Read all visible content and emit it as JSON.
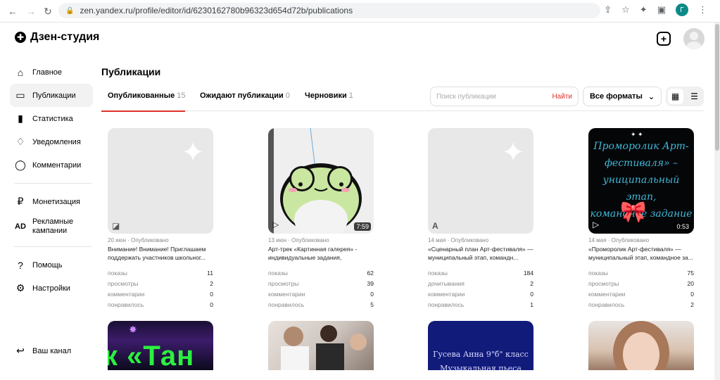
{
  "browser": {
    "url": "zen.yandex.ru/profile/editor/id/6230162780b96323d654d72b/publications",
    "profile_initial": "Г"
  },
  "app": {
    "logo_text": "Дзен-студия"
  },
  "sidebar": {
    "items": [
      {
        "label": "Главное",
        "icon": "home-icon"
      },
      {
        "label": "Публикации",
        "icon": "publications-icon",
        "active": true
      },
      {
        "label": "Статистика",
        "icon": "stats-icon"
      },
      {
        "label": "Уведомления",
        "icon": "bell-icon"
      },
      {
        "label": "Комментарии",
        "icon": "comment-icon"
      },
      {
        "label": "Монетизация",
        "icon": "ruble-icon"
      },
      {
        "label": "Рекламные кампании",
        "icon": "ad-icon"
      },
      {
        "label": "Помощь",
        "icon": "help-icon"
      },
      {
        "label": "Настройки",
        "icon": "gear-icon"
      }
    ],
    "bottom": {
      "label": "Ваш канал",
      "icon": "exit-icon"
    }
  },
  "main": {
    "title": "Публикации",
    "tabs": [
      {
        "label": "Опубликованные",
        "count": "15",
        "active": true
      },
      {
        "label": "Ожидают публикации",
        "count": "0"
      },
      {
        "label": "Черновики",
        "count": "1"
      }
    ],
    "search": {
      "placeholder": "Поиск публикации",
      "button": "Найти"
    },
    "formats": {
      "label": "Все форматы"
    }
  },
  "cards": [
    {
      "meta": "20 июн · Опубликовано",
      "title": "Внимание! Внимание! Приглашаем поддержать участников школьног...",
      "stats": [
        {
          "k": "показы",
          "v": "11"
        },
        {
          "k": "просмотры",
          "v": "2"
        },
        {
          "k": "комментарии",
          "v": "0"
        },
        {
          "k": "понравилось",
          "v": "0"
        }
      ]
    },
    {
      "meta": "13 июн · Опубликовано",
      "title": "Арт-трек «Картинная галерея» - индивидуальные задания, региональ...",
      "duration": "7:59",
      "stats": [
        {
          "k": "показы",
          "v": "62"
        },
        {
          "k": "просмотры",
          "v": "39"
        },
        {
          "k": "комментарии",
          "v": "0"
        },
        {
          "k": "понравилось",
          "v": "5"
        }
      ]
    },
    {
      "meta": "14 мая · Опубликовано",
      "title": "«Сценарный план Арт-фестиваля» — муниципальный этап, командн...",
      "type_letter": "A",
      "stats": [
        {
          "k": "показы",
          "v": "184"
        },
        {
          "k": "дочитывания",
          "v": "2"
        },
        {
          "k": "комментарии",
          "v": "0"
        },
        {
          "k": "понравилось",
          "v": "1"
        }
      ]
    },
    {
      "meta": "14 мая · Опубликовано",
      "title": "«Проморолик Арт-фестиваля» — муниципальный этап, командное за...",
      "duration": "0:53",
      "promo_lines": [
        "Проморолик Арт-",
        "фестиваля» –",
        "униципальный этап,",
        "командное задание"
      ],
      "stats": [
        {
          "k": "показы",
          "v": "75"
        },
        {
          "k": "просмотры",
          "v": "20"
        },
        {
          "k": "комментарии",
          "v": "0"
        },
        {
          "k": "понравилось",
          "v": "2"
        }
      ]
    }
  ],
  "row2": {
    "tango_text": "к «Тан",
    "blue_lines": [
      "Гусева Анна 9\"б\" класс",
      "Музыкальная пьеса"
    ]
  }
}
